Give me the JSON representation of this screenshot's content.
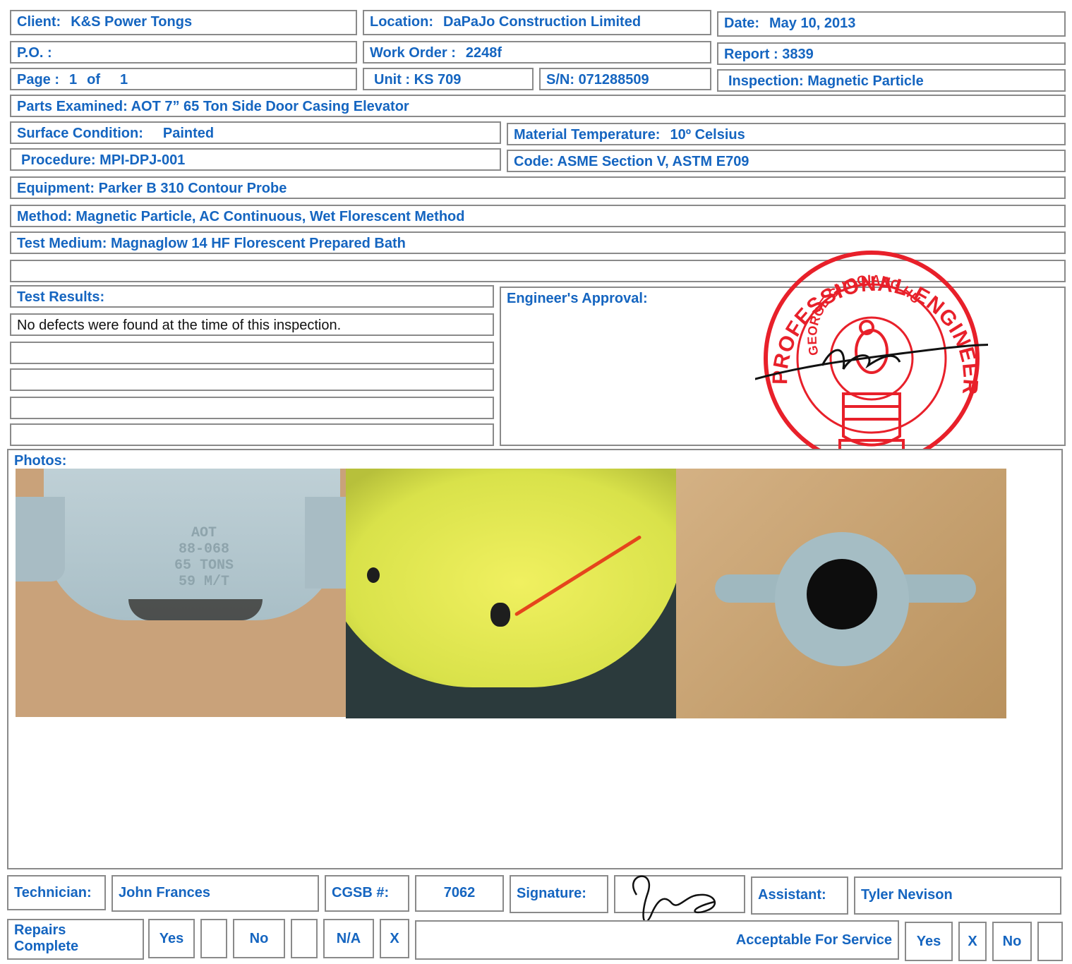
{
  "header": {
    "client_label": "Client:",
    "client": "K&S Power Tongs",
    "location_label": "Location:",
    "location": "DaPaJo Construction Limited",
    "date_label": "Date:",
    "date": "May 10, 2013",
    "po_label": "P.O. :",
    "po": "",
    "work_order_label": "Work Order :",
    "work_order": "2248f",
    "report_label": "Report :",
    "report": "3839",
    "page_label": "Page :",
    "page": "1",
    "of_label": "of",
    "page_total": "1",
    "unit_label": "Unit :",
    "unit": "KS 709",
    "sn_label": "S/N:",
    "sn": "071288509",
    "inspection_label": "Inspection:",
    "inspection": "Magnetic Particle"
  },
  "details": {
    "parts_label": "Parts Examined:",
    "parts": "AOT 7” 65 Ton Side Door Casing Elevator",
    "surface_label": "Surface Condition:",
    "surface": "Painted",
    "material_temp_label": "Material Temperature:",
    "material_temp": "10º Celsius",
    "procedure_label": "Procedure:",
    "procedure": "MPI-DPJ-001",
    "code_label": "Code:",
    "code": "ASME Section V,  ASTM E709",
    "equipment_label": "Equipment:",
    "equipment": "Parker B 310 Contour Probe",
    "method_label": "Method:",
    "method": "Magnetic Particle, AC Continuous, Wet Florescent   Method",
    "test_medium_label": "Test Medium:",
    "test_medium": "Magnaglow 14 HF Florescent Prepared Bath"
  },
  "results": {
    "label": "Test Results:",
    "lines": [
      "No defects were found at the time of this inspection.",
      "",
      "",
      "",
      ""
    ]
  },
  "approval": {
    "label": "Engineer's Approval:"
  },
  "stamp": {
    "outer_text": "PROFESSIONAL ENGINEER ALBERTA",
    "inner_text": "GEORGE GUOQIANG HU"
  },
  "photos": {
    "label": "Photos:",
    "casting_text": [
      "AOT",
      "88-068",
      "65 TONS",
      "59 M/T"
    ]
  },
  "footer": {
    "technician_label": "Technician:",
    "technician": "John Frances",
    "cgsb_label": "CGSB #:",
    "cgsb": "7062",
    "signature_label": "Signature:",
    "assistant_label": "Assistant:",
    "assistant": "Tyler Nevison",
    "repairs_label_1": "Repairs",
    "repairs_label_2": "Complete",
    "yes_label": "Yes",
    "yes_mark": "",
    "no_label": "No",
    "no_mark": "",
    "na_label": "N/A",
    "na_mark": "X",
    "acceptable_label": "Acceptable For Service",
    "accept_yes_label": "Yes",
    "accept_yes_mark": "X",
    "accept_no_label": "No",
    "accept_no_mark": ""
  },
  "colors": {
    "label_blue": "#1565c0",
    "stamp_red": "#e8202a",
    "border": "#8a8a8a"
  }
}
